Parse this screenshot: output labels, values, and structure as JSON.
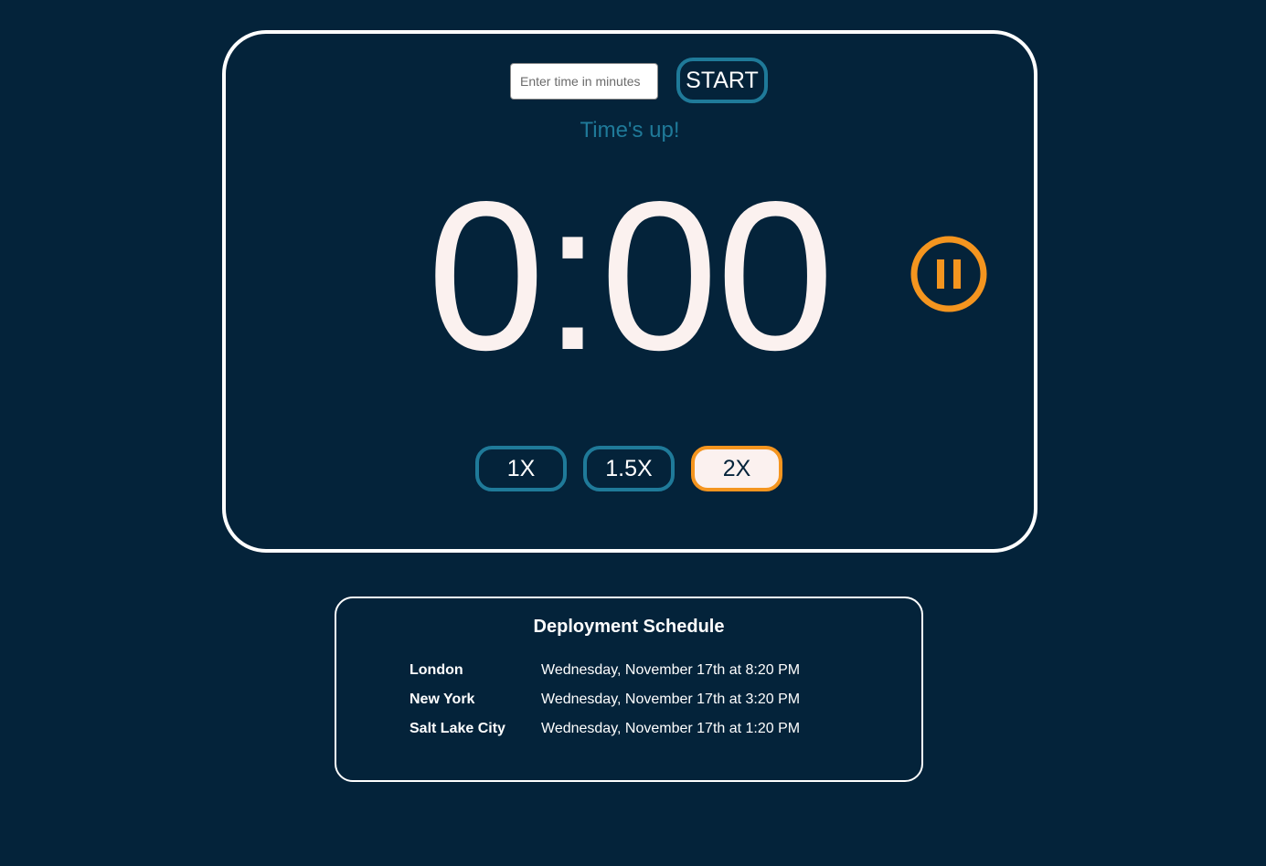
{
  "timer": {
    "input_placeholder": "Enter time in minutes",
    "input_value": "",
    "start_label": "START",
    "status_text": "Time's up!",
    "display": "0:00",
    "pause_icon": "pause-circle-icon",
    "speeds": [
      {
        "label": "1X",
        "active": false
      },
      {
        "label": "1.5X",
        "active": false
      },
      {
        "label": "2X",
        "active": true
      }
    ]
  },
  "schedule": {
    "title": "Deployment Schedule",
    "rows": [
      {
        "city": "London",
        "time": "Wednesday, November 17th at 8:20 PM"
      },
      {
        "city": "New York",
        "time": "Wednesday, November 17th at 3:20 PM"
      },
      {
        "city": "Salt Lake City",
        "time": "Wednesday, November 17th at 1:20 PM"
      }
    ]
  },
  "colors": {
    "background": "#04233a",
    "accent_blue": "#1f7a99",
    "accent_orange": "#f4951f",
    "clock_text": "#fbf1ef",
    "border": "#ffffff"
  }
}
